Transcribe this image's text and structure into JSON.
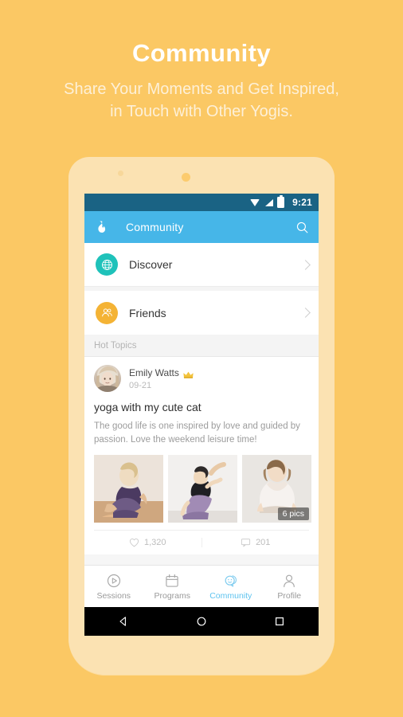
{
  "promo": {
    "title": "Community",
    "subtitle_line1": "Share Your Moments and Get Inspired,",
    "subtitle_line2": "in Touch with Other Yogis."
  },
  "colors": {
    "background": "#FBC864",
    "phone_frame": "#FBE2B2",
    "statusbar": "#1A6384",
    "appbar": "#46B6E8",
    "accent_active": "#5EC3EF",
    "discover_icon_bg": "#1FC2BA",
    "friends_icon_bg": "#F4B335",
    "crown": "#F3C33C"
  },
  "statusbar": {
    "time": "9:21",
    "wifi_icon": "wifi-icon",
    "signal_icon": "signal-icon",
    "battery_icon": "battery-icon"
  },
  "appbar": {
    "logo_icon": "flame-logo-icon",
    "title": "Community",
    "search_icon": "search-icon"
  },
  "menu": {
    "items": [
      {
        "label": "Discover",
        "icon": "globe-icon",
        "chevron": "chevron-right-icon"
      },
      {
        "label": "Friends",
        "icon": "people-icon",
        "chevron": "chevron-right-icon"
      }
    ]
  },
  "section": {
    "hot_topics_label": "Hot Topics"
  },
  "post": {
    "author": "Emily Watts",
    "badge_icon": "crown-icon",
    "date": "09-21",
    "title": "yoga with my cute cat",
    "body": "The good life is one inspired by love and guided by passion. Love the weekend leisure time!",
    "photos_count_badge": "6 pics",
    "photos": [
      {
        "alt": "yoga seated twist pose"
      },
      {
        "alt": "yoga backbend stretch pose"
      },
      {
        "alt": "yoga lotus meditation pose"
      }
    ],
    "like_icon": "heart-icon",
    "like_count": "1,320",
    "comment_icon": "comment-icon",
    "comment_count": "201"
  },
  "tabbar": {
    "tabs": [
      {
        "label": "Sessions",
        "icon": "play-circle-icon",
        "active": false
      },
      {
        "label": "Programs",
        "icon": "calendar-icon",
        "active": false
      },
      {
        "label": "Community",
        "icon": "chat-bubble-smiley-icon",
        "active": true
      },
      {
        "label": "Profile",
        "icon": "person-icon",
        "active": false
      }
    ]
  },
  "navbar": {
    "back_icon": "back-triangle-icon",
    "home_icon": "home-circle-icon",
    "recents_icon": "recents-square-icon"
  }
}
